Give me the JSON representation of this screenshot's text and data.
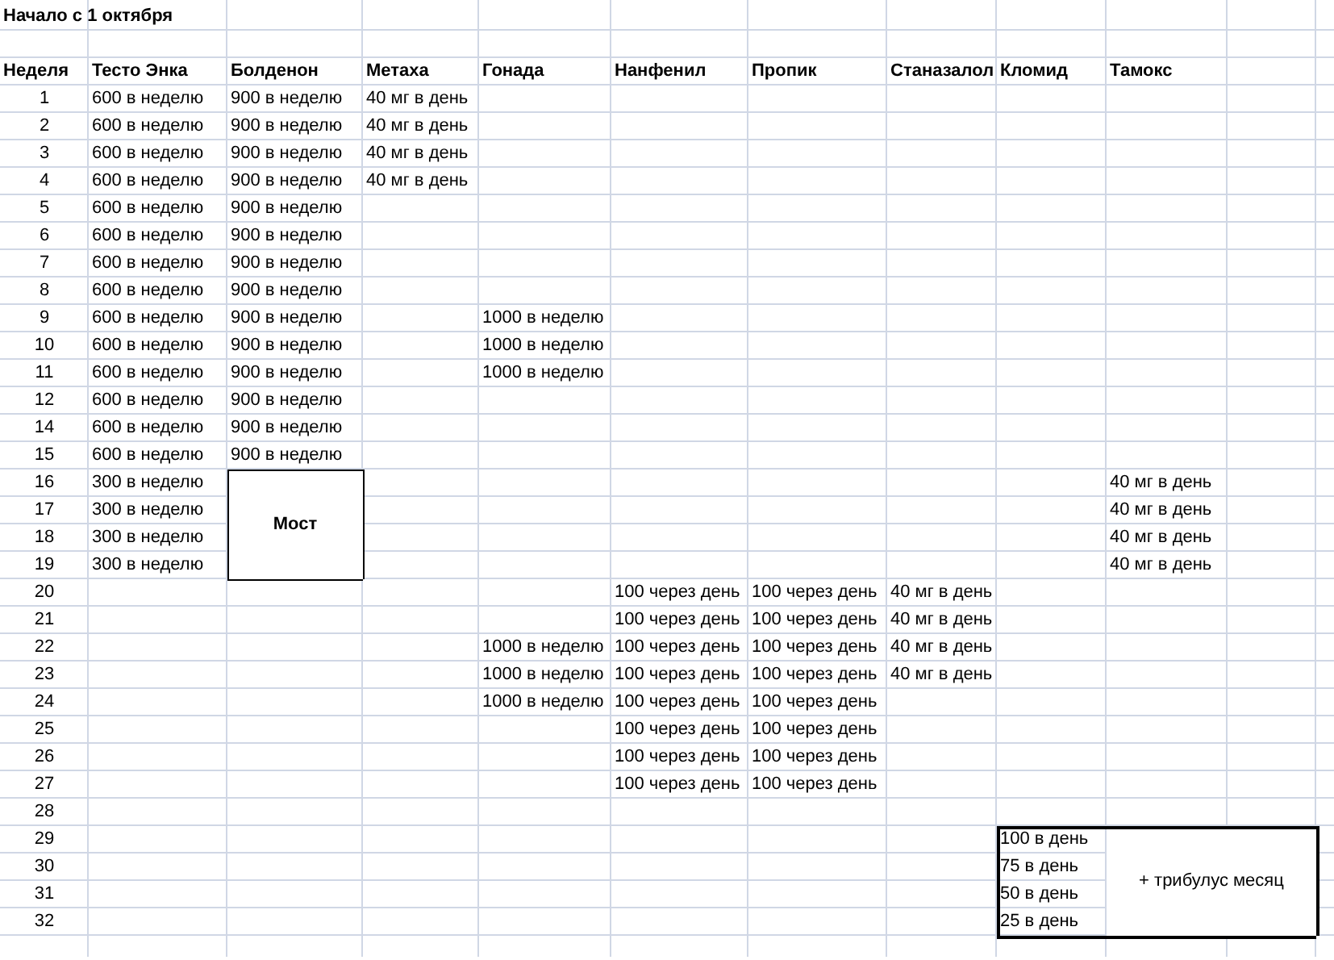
{
  "title": "Начало с 1 октября",
  "columns": [
    "Неделя",
    "Тесто Энка",
    "Болденон",
    "Метаха",
    "Гонада",
    "Нанфенил",
    "Пропик",
    "Станазалол",
    "Кломид",
    "Тамокс"
  ],
  "rows": [
    {
      "week": "1",
      "cells": [
        "600 в неделю",
        "900 в неделю",
        "40 мг в день"
      ]
    },
    {
      "week": "2",
      "cells": [
        "600 в неделю",
        "900 в неделю",
        "40 мг в день"
      ]
    },
    {
      "week": "3",
      "cells": [
        "600 в неделю",
        "900 в неделю",
        "40 мг в день"
      ]
    },
    {
      "week": "4",
      "cells": [
        "600 в неделю",
        "900 в неделю",
        "40 мг в день"
      ]
    },
    {
      "week": "5",
      "cells": [
        "600 в неделю",
        "900 в неделю"
      ]
    },
    {
      "week": "6",
      "cells": [
        "600 в неделю",
        "900 в неделю"
      ]
    },
    {
      "week": "7",
      "cells": [
        "600 в неделю",
        "900 в неделю"
      ]
    },
    {
      "week": "8",
      "cells": [
        "600 в неделю",
        "900 в неделю"
      ]
    },
    {
      "week": "9",
      "cells": [
        "600 в неделю",
        "900 в неделю",
        null,
        "1000 в неделю"
      ]
    },
    {
      "week": "10",
      "cells": [
        "600 в неделю",
        "900 в неделю",
        null,
        "1000 в неделю"
      ]
    },
    {
      "week": "11",
      "cells": [
        "600 в неделю",
        "900 в неделю",
        null,
        "1000 в неделю"
      ]
    },
    {
      "week": "12",
      "cells": [
        "600 в неделю",
        "900 в неделю"
      ]
    },
    {
      "week": "14",
      "cells": [
        "600 в неделю",
        "900 в неделю"
      ]
    },
    {
      "week": "15",
      "cells": [
        "600 в неделю",
        "900 в неделю"
      ]
    },
    {
      "week": "16",
      "cells": [
        "300 в неделю",
        {
          "kind": "merged",
          "text": "Мост",
          "outlined": true
        },
        null,
        null,
        null,
        null,
        null,
        null,
        "40 мг в день"
      ]
    },
    {
      "week": "17",
      "cells": [
        "300 в неделю",
        {
          "kind": "continued"
        },
        null,
        null,
        null,
        null,
        null,
        null,
        "40 мг в день"
      ]
    },
    {
      "week": "18",
      "cells": [
        "300 в неделю",
        {
          "kind": "continued"
        },
        null,
        null,
        null,
        null,
        null,
        null,
        "40 мг в день"
      ]
    },
    {
      "week": "19",
      "cells": [
        "300 в неделю",
        {
          "kind": "continued"
        },
        null,
        null,
        null,
        null,
        null,
        null,
        "40 мг в день"
      ]
    },
    {
      "week": "20",
      "cells": [
        null,
        null,
        null,
        null,
        "100 через день",
        "100 через день",
        "40 мг в день"
      ]
    },
    {
      "week": "21",
      "cells": [
        null,
        null,
        null,
        null,
        "100 через день",
        "100 через день",
        "40 мг в день"
      ]
    },
    {
      "week": "22",
      "cells": [
        null,
        null,
        null,
        "1000 в неделю",
        "100 через день",
        "100 через день",
        "40 мг в день"
      ]
    },
    {
      "week": "23",
      "cells": [
        null,
        null,
        null,
        "1000 в неделю",
        "100 через день",
        "100 через день",
        "40 мг в день"
      ]
    },
    {
      "week": "24",
      "cells": [
        null,
        null,
        null,
        "1000 в неделю",
        "100 через день",
        "100 через день"
      ]
    },
    {
      "week": "25",
      "cells": [
        null,
        null,
        null,
        null,
        "100 через день",
        "100 через день"
      ]
    },
    {
      "week": "26",
      "cells": [
        null,
        null,
        null,
        null,
        "100 через день",
        "100 через день"
      ]
    },
    {
      "week": "27",
      "cells": [
        null,
        null,
        null,
        null,
        "100 через день",
        "100 через день"
      ]
    },
    {
      "week": "28",
      "cells": []
    },
    {
      "week": "29",
      "cells": [
        null,
        null,
        null,
        null,
        null,
        null,
        null,
        {
          "kind": "plain",
          "text": "100 в день",
          "heavy_outline": true
        },
        {
          "kind": "merged",
          "text": "+ трибулус месяц",
          "heavy_outline": true
        },
        {
          "kind": "continued"
        }
      ]
    },
    {
      "week": "30",
      "cells": [
        null,
        null,
        null,
        null,
        null,
        null,
        null,
        {
          "kind": "plain",
          "text": "75 в день",
          "heavy_outline": true
        },
        {
          "kind": "continued"
        },
        {
          "kind": "continued"
        }
      ]
    },
    {
      "week": "31",
      "cells": [
        null,
        null,
        null,
        null,
        null,
        null,
        null,
        {
          "kind": "plain",
          "text": "50 в день",
          "heavy_outline": true
        },
        {
          "kind": "continued"
        },
        {
          "kind": "continued"
        }
      ]
    },
    {
      "week": "32",
      "cells": [
        null,
        null,
        null,
        null,
        null,
        null,
        null,
        {
          "kind": "plain",
          "text": "25 в день",
          "heavy_outline": true
        },
        {
          "kind": "continued"
        },
        {
          "kind": "continued"
        }
      ]
    }
  ]
}
